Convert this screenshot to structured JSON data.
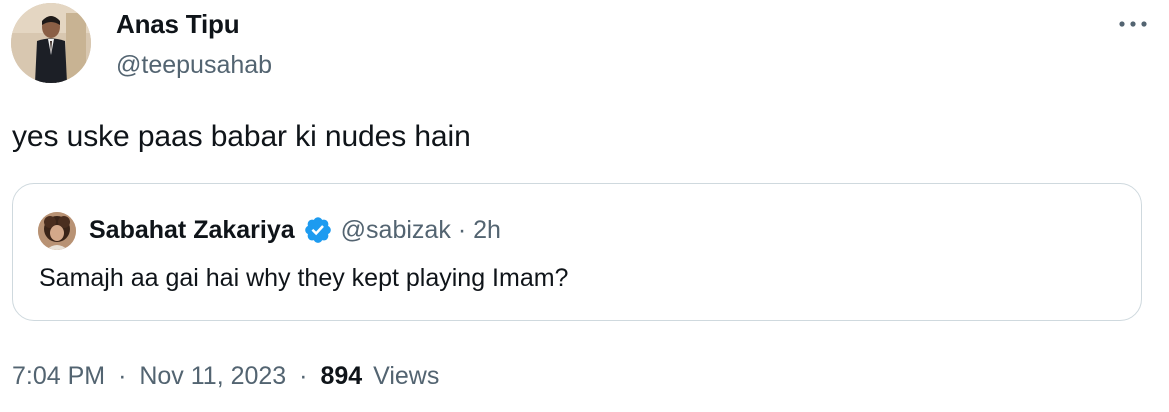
{
  "tweet": {
    "author": {
      "name": "Anas Tipu",
      "handle": "@teepusahab"
    },
    "text": "yes uske paas babar ki nudes hain",
    "more_icon": "more-horizontal-icon"
  },
  "quoted_tweet": {
    "author": {
      "name": "Sabahat Zakariya",
      "handle": "@sabizak",
      "verified_icon": "verified-badge-icon"
    },
    "separator": "·",
    "time_ago": "2h",
    "text": "Samajh aa gai hai why they kept playing Imam?"
  },
  "footer": {
    "time": "7:04 PM",
    "date": "Nov 11, 2023",
    "separator": "·",
    "views_count": "894",
    "views_label": "Views"
  },
  "colors": {
    "text": "#0f1419",
    "secondary": "#536471",
    "border": "#cfd9de",
    "verified": "#1d9bf0"
  }
}
